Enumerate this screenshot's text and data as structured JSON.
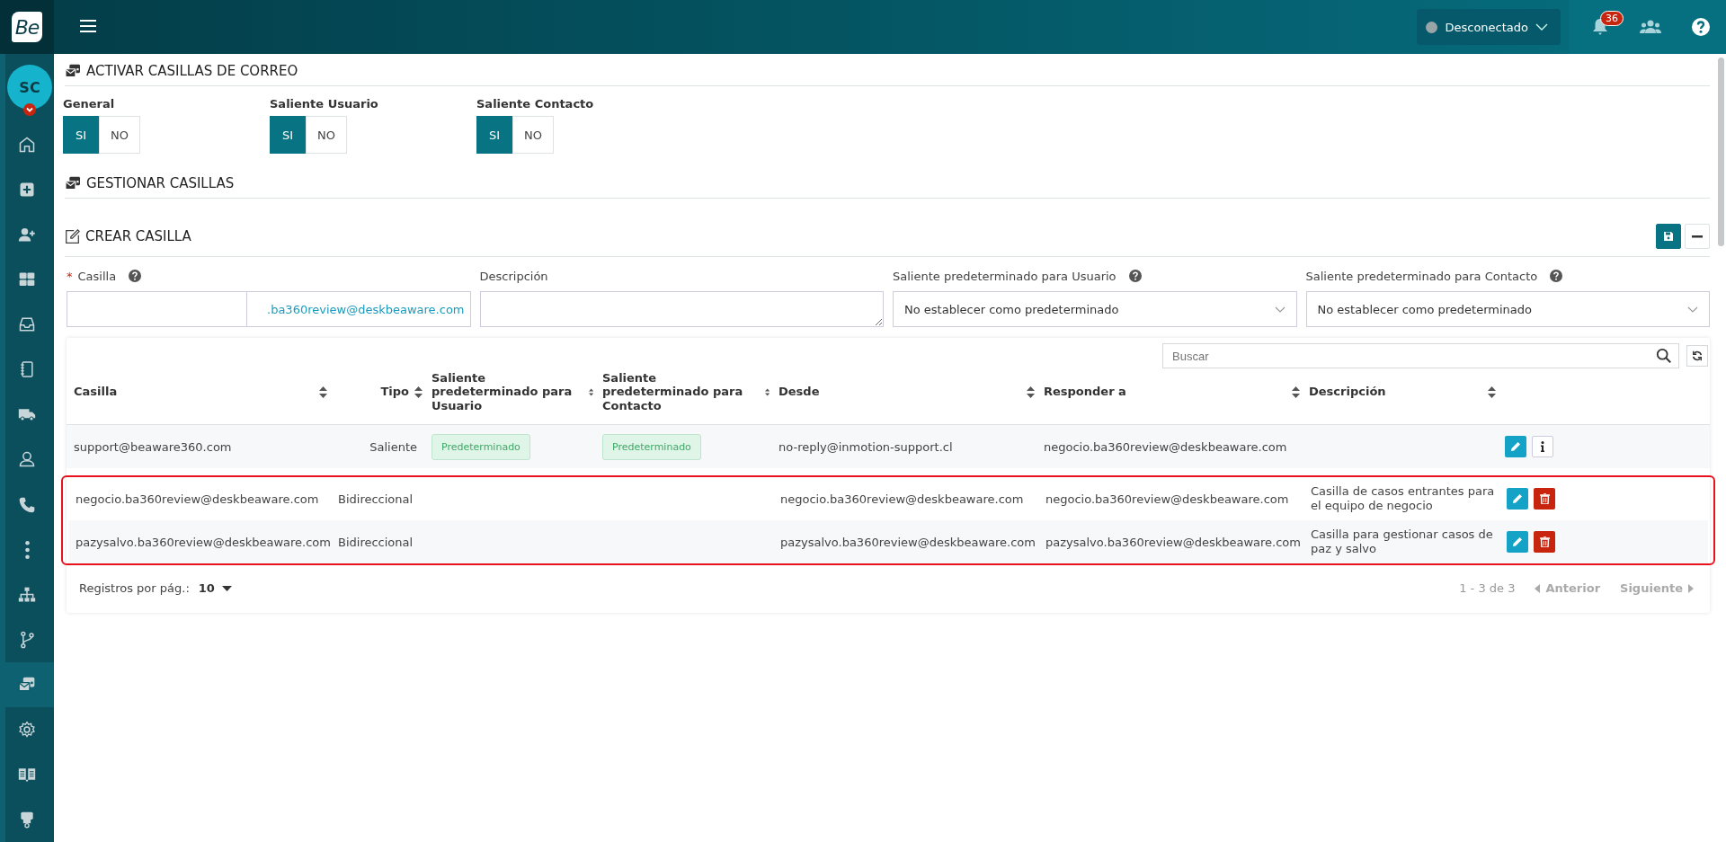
{
  "topbar": {
    "logo": "Be",
    "status": {
      "label": "Desconectado",
      "online": false
    },
    "notifications": {
      "count": "36"
    }
  },
  "sidebar": {
    "avatar": "SC",
    "items": [
      {
        "kind": "home",
        "selected": false
      },
      {
        "kind": "plus",
        "selected": false
      },
      {
        "kind": "user-plus",
        "selected": false
      },
      {
        "kind": "grid",
        "selected": false
      },
      {
        "kind": "inbox",
        "selected": false
      },
      {
        "kind": "notebook",
        "selected": false
      },
      {
        "kind": "truck",
        "selected": false
      },
      {
        "kind": "user",
        "selected": false
      },
      {
        "kind": "phone",
        "selected": false
      },
      {
        "kind": "dots",
        "selected": false
      },
      {
        "kind": "sitemap",
        "selected": false
      },
      {
        "kind": "branch",
        "selected": false
      },
      {
        "kind": "mail",
        "selected": true
      },
      {
        "kind": "gear",
        "selected": false
      },
      {
        "kind": "book",
        "selected": false
      },
      {
        "kind": "plug",
        "selected": false
      }
    ]
  },
  "activar": {
    "title": "ACTIVAR CASILLAS DE CORREO",
    "toggles": [
      {
        "label": "General",
        "options": [
          {
            "label": "SI",
            "selected": true
          },
          {
            "label": "NO",
            "selected": false
          }
        ]
      },
      {
        "label": "Saliente Usuario",
        "options": [
          {
            "label": "SI",
            "selected": true
          },
          {
            "label": "NO",
            "selected": false
          }
        ]
      },
      {
        "label": "Saliente Contacto",
        "options": [
          {
            "label": "SI",
            "selected": true
          },
          {
            "label": "NO",
            "selected": false
          }
        ]
      }
    ]
  },
  "gestionar": {
    "title": "GESTIONAR CASILLAS"
  },
  "crear": {
    "title": "CREAR CASILLA",
    "fields": [
      {
        "kind": "email",
        "label": "Casilla",
        "required_mark": "*",
        "help": true,
        "suffix": ".ba360review@deskbeaware.com"
      },
      {
        "kind": "textarea",
        "label": "Descripción",
        "help": false
      },
      {
        "kind": "select",
        "label": "Saliente predeterminado para Usuario",
        "help": true,
        "value": "No establecer como predeterminado"
      },
      {
        "kind": "select",
        "label": "Saliente predeterminado para Contacto",
        "help": true,
        "value": "No establecer como predeterminado"
      }
    ]
  },
  "table": {
    "search": {
      "placeholder": "Buscar"
    },
    "columns": [
      {
        "label": "Casilla"
      },
      {
        "label": "Tipo"
      },
      {
        "label": "Saliente predeterminado para Usuario"
      },
      {
        "label": "Saliente predeterminado para Contacto"
      },
      {
        "label": "Desde"
      },
      {
        "label": "Responder a"
      },
      {
        "label": "Descripción"
      }
    ],
    "rows": [
      {
        "highlighted": false,
        "cells": [
          "support@beaware360.com",
          "Saliente",
          "Predeterminado",
          "Predeterminado",
          "no-reply@inmotion-support.cl",
          "negocio.ba360review@deskbeaware.com",
          ""
        ],
        "actions": [
          {
            "kind": "edit"
          },
          {
            "kind": "info"
          }
        ]
      },
      {
        "highlighted": true,
        "cells": [
          "negocio.ba360review@deskbeaware.com",
          "Bidireccional",
          "",
          "",
          "negocio.ba360review@deskbeaware.com",
          "negocio.ba360review@deskbeaware.com",
          "Casilla de casos entrantes para el equipo de negocio"
        ],
        "actions": [
          {
            "kind": "edit"
          },
          {
            "kind": "delete"
          }
        ]
      },
      {
        "highlighted": true,
        "cells": [
          "pazysalvo.ba360review@deskbeaware.com",
          "Bidireccional",
          "",
          "",
          "pazysalvo.ba360review@deskbeaware.com",
          "pazysalvo.ba360review@deskbeaware.com",
          "Casilla para gestionar casos de paz y salvo"
        ],
        "actions": [
          {
            "kind": "edit"
          },
          {
            "kind": "delete"
          }
        ]
      }
    ],
    "pagination": {
      "per_page_label": "Registros por pág.:",
      "per_page": "10",
      "range": "1 - 3 de 3",
      "previous": {
        "label": "Anterior",
        "disabled": true
      },
      "next": {
        "label": "Siguiente",
        "disabled": true
      }
    }
  }
}
